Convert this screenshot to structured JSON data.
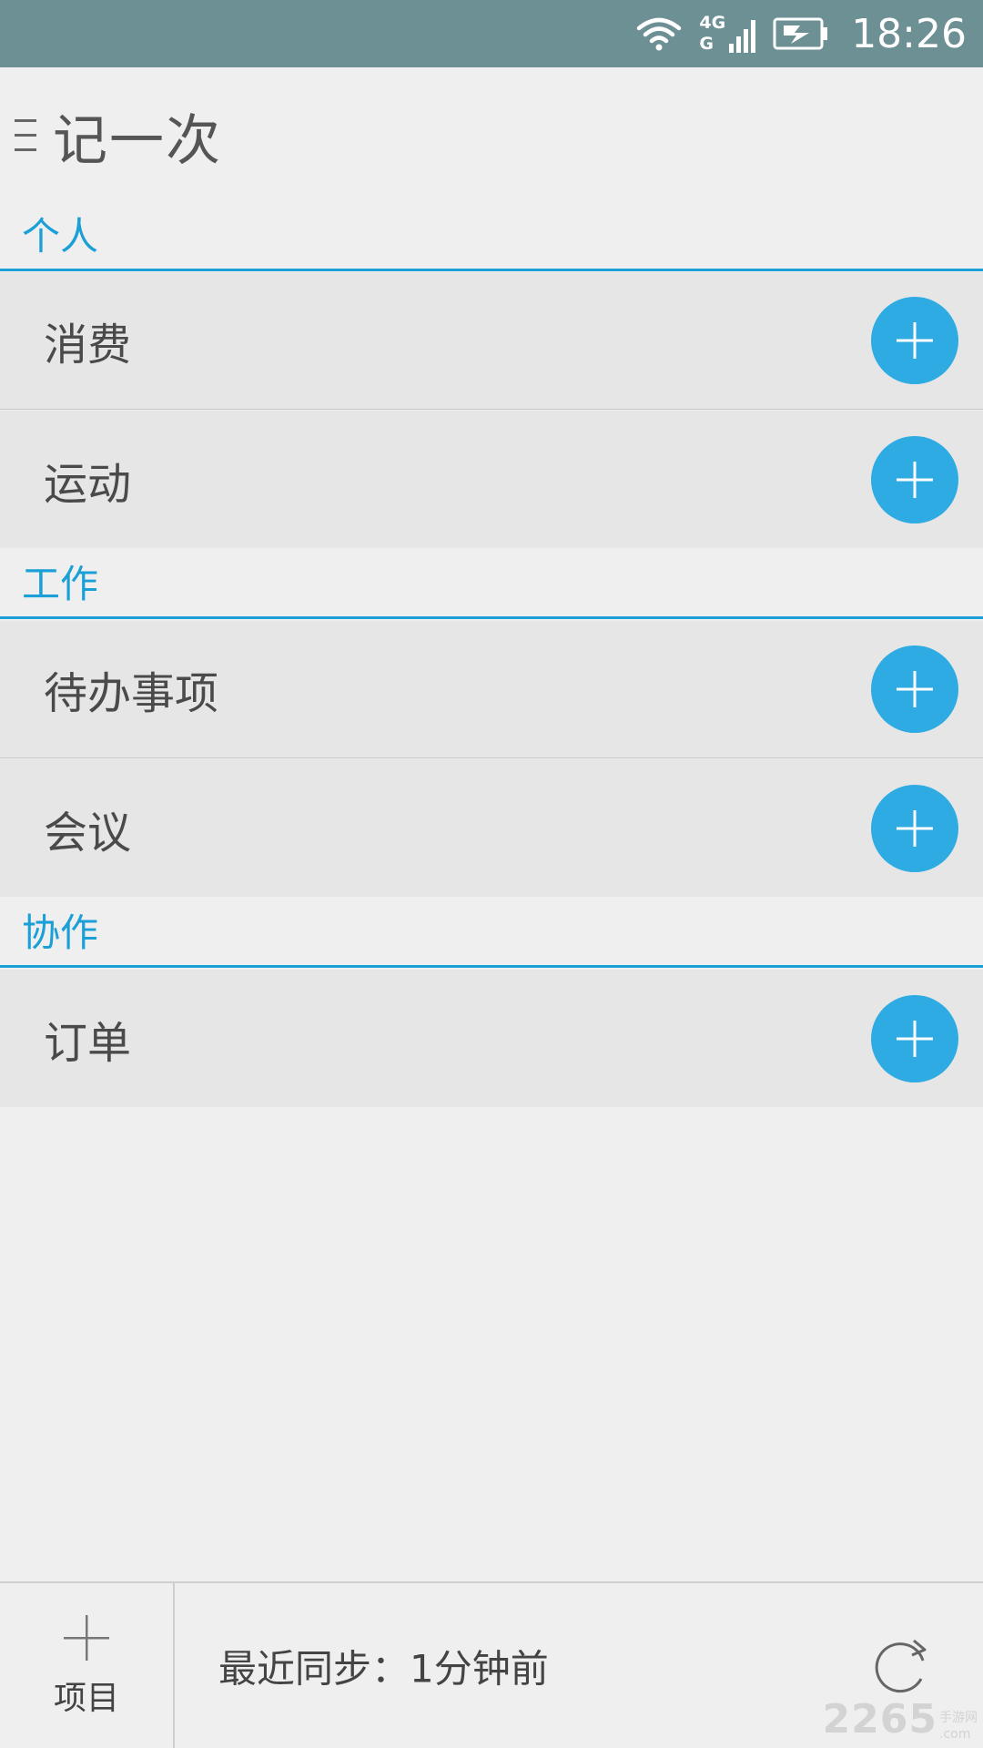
{
  "status_bar": {
    "network_label_top": "4G",
    "network_label_bottom": "G",
    "time": "18:26",
    "icons": [
      "wifi-icon",
      "signal-icon",
      "battery-charging-icon"
    ]
  },
  "header": {
    "title": "记一次",
    "menu_icon": "menu-icon"
  },
  "sections": [
    {
      "title": "个人",
      "items": [
        "消费",
        "运动"
      ]
    },
    {
      "title": "工作",
      "items": [
        "待办事项",
        "会议"
      ]
    },
    {
      "title": "协作",
      "items": [
        "订单"
      ]
    }
  ],
  "colors": {
    "accent": "#1a9fd6",
    "button": "#2eabe2",
    "status_bar": "#6d9095",
    "row_bg": "#e6e6e6",
    "page_bg": "#efefef"
  },
  "bottom_bar": {
    "project_label": "项目",
    "sync_text": "最近同步：1分钟前",
    "refresh_icon": "refresh-icon"
  },
  "watermark": {
    "number": "2265",
    "line1": "手游网",
    "line2": ".com"
  }
}
